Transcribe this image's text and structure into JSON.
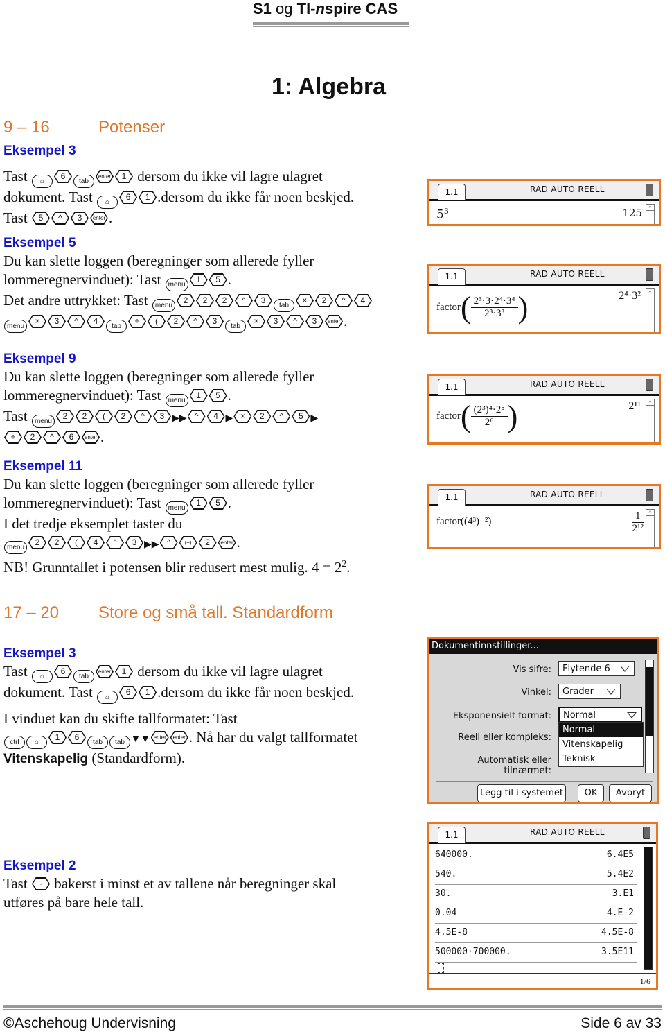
{
  "header": {
    "title_s1": "S1",
    "title_og": " og ",
    "title_ti": "TI-",
    "title_n": "n",
    "title_rest": "spire CAS"
  },
  "chapter": "1: Algebra",
  "sections": [
    {
      "num": "9 – 16",
      "title": "Potenser"
    },
    {
      "num": "17 – 20",
      "title": "Store og små tall. Standardform"
    }
  ],
  "examples": {
    "ex3a": {
      "title": "Eksempel 3",
      "t1": "Tast",
      "t2": "dersom du ikke vil lagre ulagret",
      "t3": "dokument. Tast",
      "t4": ".dersom du ikke får noen beskjed.",
      "t5": "Tast",
      "t6": "."
    },
    "ex5": {
      "title": "Eksempel 5",
      "t1": "Du kan slette loggen (beregninger som allerede fyller",
      "t2": "lommeregnervinduet): Tast",
      "t3": ".",
      "t4": "Det andre uttrykket: Tast",
      "t5": "."
    },
    "ex9": {
      "title": "Eksempel 9",
      "t1": "Du kan slette loggen (beregninger som allerede fyller",
      "t2": "lommeregnervinduet): Tast",
      "t3": ".",
      "t4": "Tast",
      "t5": "."
    },
    "ex11": {
      "title": "Eksempel 11",
      "t1": "Du kan slette loggen (beregninger som allerede fyller",
      "t2": "lommeregnervinduet): Tast",
      "t3": ".",
      "t4": "I det tredje eksemplet taster du",
      "t5": ".",
      "t6": "NB! Grunntallet i potensen blir redusert mest mulig. 4 = 2",
      "t6sup": "2",
      "t6end": "."
    },
    "ex3b": {
      "title": "Eksempel 3",
      "t1": "Tast",
      "t2": "dersom du ikke vil lagre ulagret",
      "t3": "dokument. Tast",
      "t4": ".dersom du ikke får noen beskjed.",
      "t5": "I vinduet kan du skifte tallformatet: Tast",
      "t6": ". Nå har du valgt tallformatet",
      "t7b": "Vitenskapelig",
      "t7": " (Standardform)."
    },
    "ex2": {
      "title": "Eksempel 2",
      "t1": "Tast",
      "t2": "bakerst i minst et av tallene når beregninger skal",
      "t3": "utføres på bare hele tall."
    }
  },
  "keys": {
    "home": "⌂",
    "tab": "tab",
    "enter": "enter",
    "menu": "menu",
    "ctrl": "ctrl",
    "pow": "^",
    "mul": "×",
    "div": "÷",
    "paren": "(",
    "neg": "(−)",
    "dot": "·",
    "right": "▶",
    "down": "▼"
  },
  "calc": {
    "tab": "1.1",
    "mode": "RAD AUTO REELL",
    "s1": {
      "input_base": "5",
      "input_exp": "3",
      "result": "125"
    },
    "s2": {
      "fn": "factor",
      "num": "2³·3·2⁴·3⁴",
      "den": "2³·3³",
      "result": "2⁴·3²"
    },
    "s3": {
      "fn": "factor",
      "num": "(2³)⁴·2⁵",
      "den": "2⁶",
      "result": "2¹¹"
    },
    "s4": {
      "fn": "factor",
      "expr": "((4³)⁻²)",
      "res_num": "1",
      "res_den": "2¹²"
    },
    "s6": {
      "rows": [
        {
          "in": "640000.",
          "out": "6.4E5"
        },
        {
          "in": "540.",
          "out": "5.4E2"
        },
        {
          "in": "30.",
          "out": "3.E1"
        },
        {
          "in": "0.04",
          "out": "4.E-2"
        },
        {
          "in": "4.5E-8",
          "out": "4.5E-8"
        },
        {
          "in": "500000·700000.",
          "out": "3.5E11"
        }
      ],
      "page": "1/6"
    }
  },
  "dialog": {
    "title": "Dokumentinnstillinger...",
    "vis_sifre_label": "Vis sifre:",
    "vis_sifre_value": "Flytende 6",
    "vinkel_label": "Vinkel:",
    "vinkel_value": "Grader",
    "eksp_label": "Eksponensielt format:",
    "eksp_value": "Normal",
    "reell_label": "Reell eller kompleks:",
    "auto_label": "Automatisk eller tilnærmet:",
    "options": [
      "Normal",
      "Vitenskapelig",
      "Teknisk"
    ],
    "btn_system": "Legg til i systemet",
    "btn_ok": "OK",
    "btn_cancel": "Avbryt"
  },
  "footer": {
    "left": "©Aschehoug Undervisning",
    "right": "Side 6 av 33"
  }
}
